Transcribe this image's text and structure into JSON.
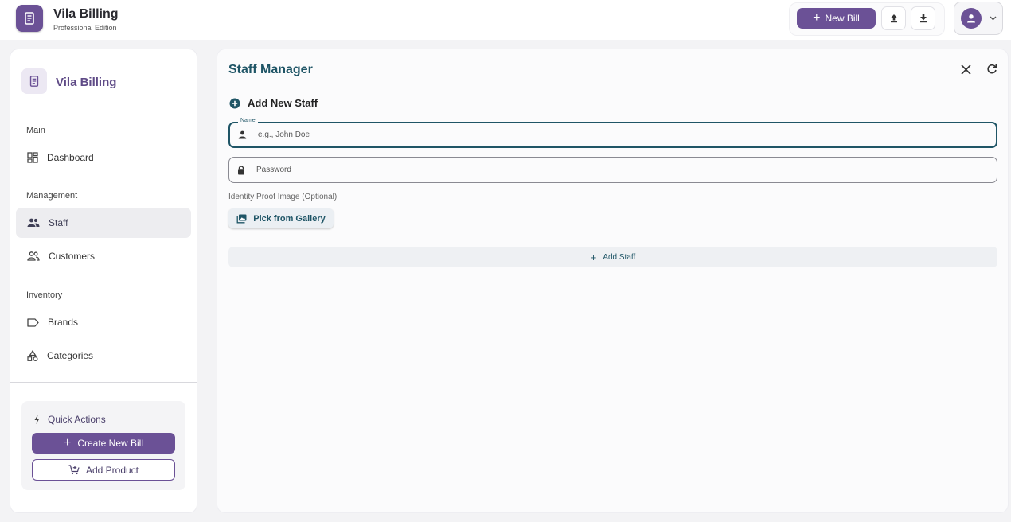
{
  "header": {
    "app_name": "Vila Billing",
    "edition": "Professional Edition",
    "new_bill_label": "New Bill",
    "icons": [
      "receipt-icon",
      "upload-icon",
      "download-icon",
      "account-icon",
      "chevron-down-icon"
    ]
  },
  "sidebar": {
    "brand_name": "Vila Billing",
    "sections": {
      "main": "Main",
      "management": "Management",
      "inventory": "Inventory"
    },
    "items": {
      "dashboard": "Dashboard",
      "staff": "Staff",
      "customers": "Customers",
      "brands": "Brands",
      "categories": "Categories"
    },
    "active_item": "Staff",
    "quick_actions": {
      "title": "Quick Actions",
      "create_bill": "Create New Bill",
      "add_product": "Add Product"
    }
  },
  "main": {
    "title": "Staff Manager",
    "section_title": "Add New Staff",
    "name_field": {
      "legend": "Name",
      "placeholder": "e.g., John Doe",
      "value": ""
    },
    "password_field": {
      "placeholder": "Password",
      "value": ""
    },
    "id_proof_label": "Identity Proof Image (Optional)",
    "gallery_button": "Pick from Gallery",
    "add_staff_button": "Add Staff"
  },
  "colors": {
    "primary": "#6b5196",
    "accent": "#1f5566",
    "background": "#f3f3f5",
    "active_item_bg": "#ededf0"
  }
}
